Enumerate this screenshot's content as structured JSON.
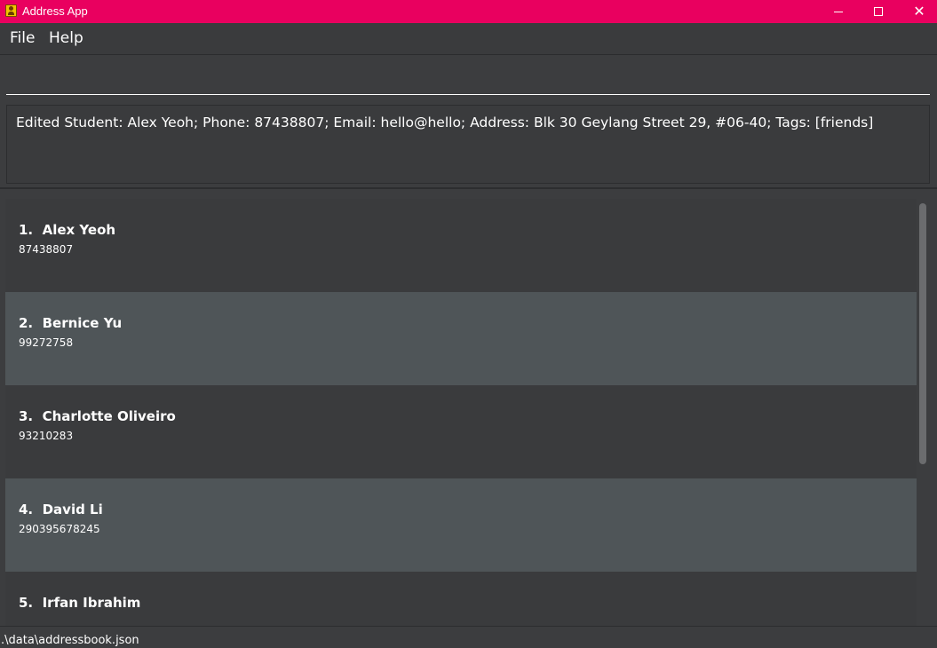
{
  "window": {
    "title": "Address App",
    "accent_color": "#e9005f",
    "app_icon": "address-book-icon",
    "controls": {
      "minimize_icon": "minimize-icon",
      "maximize_icon": "maximize-icon",
      "close_icon": "close-icon",
      "close_glyph": "✕"
    }
  },
  "menu": {
    "items": [
      {
        "label": "File"
      },
      {
        "label": "Help"
      }
    ]
  },
  "command": {
    "value": "",
    "placeholder": ""
  },
  "result": {
    "text": "Edited Student: Alex Yeoh; Phone: 87438807; Email: hello@hello; Address: Blk 30 Geylang Street 29, #06-40; Tags: [friends]"
  },
  "persons": [
    {
      "index": "1.",
      "name": "Alex Yeoh",
      "phone": "87438807"
    },
    {
      "index": "2.",
      "name": "Bernice Yu",
      "phone": "99272758"
    },
    {
      "index": "3.",
      "name": "Charlotte Oliveiro",
      "phone": "93210283"
    },
    {
      "index": "4.",
      "name": "David Li",
      "phone": "290395678245"
    },
    {
      "index": "5.",
      "name": "Irfan Ibrahim",
      "phone": ""
    }
  ],
  "colors": {
    "background": "#3c3d3f",
    "card_alt": "#4f5558",
    "text": "#ffffff"
  },
  "status": {
    "path": ".\\data\\addressbook.json"
  }
}
